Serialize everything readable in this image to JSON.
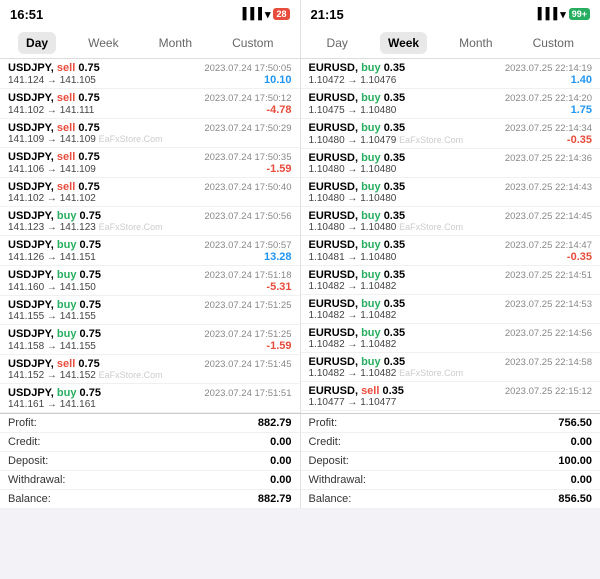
{
  "panels": {
    "left": {
      "time": "16:51",
      "battery": "28",
      "battery_color": "red",
      "active_tab": "Day",
      "tabs": [
        "Day",
        "Week",
        "Month",
        "Custom"
      ],
      "trades": [
        {
          "instrument": "USDJPY",
          "direction": "sell",
          "size": "0.75",
          "datetime": "2023.07.24 17:50:05",
          "price_from": "141.124",
          "price_to": "141.105",
          "pnl": "10.10",
          "pnl_sign": "positive"
        },
        {
          "instrument": "USDJPY",
          "direction": "sell",
          "size": "0.75",
          "datetime": "2023.07.24 17:50:12",
          "price_from": "141.102",
          "price_to": "141.111",
          "pnl": "-4.78",
          "pnl_sign": "negative"
        },
        {
          "instrument": "USDJPY",
          "direction": "sell",
          "size": "0.75",
          "datetime": "2023.07.24 17:50:29",
          "price_from": "141.109",
          "price_to": "141.109",
          "pnl": "",
          "pnl_sign": ""
        },
        {
          "instrument": "USDJPY",
          "direction": "sell",
          "size": "0.75",
          "datetime": "2023.07.24 17:50:35",
          "price_from": "141.106",
          "price_to": "141.109",
          "pnl": "-1.59",
          "pnl_sign": "negative"
        },
        {
          "instrument": "USDJPY",
          "direction": "sell",
          "size": "0.75",
          "datetime": "2023.07.24 17:50:40",
          "price_from": "141.102",
          "price_to": "141.102",
          "pnl": "",
          "pnl_sign": ""
        },
        {
          "instrument": "USDJPY",
          "direction": "buy",
          "size": "0.75",
          "datetime": "2023.07.24 17:50:56",
          "price_from": "141.123",
          "price_to": "141.123",
          "pnl": "",
          "pnl_sign": ""
        },
        {
          "instrument": "USDJPY",
          "direction": "buy",
          "size": "0.75",
          "datetime": "2023.07.24 17:50:57",
          "price_from": "141.126",
          "price_to": "141.151",
          "pnl": "13.28",
          "pnl_sign": "positive"
        },
        {
          "instrument": "USDJPY",
          "direction": "buy",
          "size": "0.75",
          "datetime": "2023.07.24 17:51:18",
          "price_from": "141.160",
          "price_to": "141.150",
          "pnl": "-5.31",
          "pnl_sign": "negative"
        },
        {
          "instrument": "USDJPY",
          "direction": "buy",
          "size": "0.75",
          "datetime": "2023.07.24 17:51:25",
          "price_from": "141.155",
          "price_to": "141.155",
          "pnl": "",
          "pnl_sign": ""
        },
        {
          "instrument": "USDJPY",
          "direction": "buy",
          "size": "0.75",
          "datetime": "2023.07.24 17:51:25",
          "price_from": "141.158",
          "price_to": "141.155",
          "pnl": "-1.59",
          "pnl_sign": "negative"
        },
        {
          "instrument": "USDJPY",
          "direction": "sell",
          "size": "0.75",
          "datetime": "2023.07.24 17:51:45",
          "price_from": "141.152",
          "price_to": "141.152",
          "pnl": "",
          "pnl_sign": ""
        },
        {
          "instrument": "USDJPY",
          "direction": "buy",
          "size": "0.75",
          "datetime": "2023.07.24 17:51:51",
          "price_from": "141.161",
          "price_to": "141.161",
          "pnl": "",
          "pnl_sign": ""
        }
      ],
      "summary": [
        {
          "label": "Profit:",
          "value": "882.79"
        },
        {
          "label": "Credit:",
          "value": "0.00"
        },
        {
          "label": "Deposit:",
          "value": "0.00"
        },
        {
          "label": "Withdrawal:",
          "value": "0.00"
        },
        {
          "label": "Balance:",
          "value": "882.79"
        }
      ]
    },
    "right": {
      "time": "21:15",
      "battery": "99+",
      "battery_color": "green",
      "active_tab": "Week",
      "tabs": [
        "Day",
        "Week",
        "Month",
        "Custom"
      ],
      "trades": [
        {
          "instrument": "EURUSD",
          "direction": "buy",
          "size": "0.35",
          "datetime": "2023.07.25 22:14:19",
          "price_from": "1.10472",
          "price_to": "1.10476",
          "pnl": "1.40",
          "pnl_sign": "positive"
        },
        {
          "instrument": "EURUSD",
          "direction": "buy",
          "size": "0.35",
          "datetime": "2023.07.25 22:14:20",
          "price_from": "1.10475",
          "price_to": "1.10480",
          "pnl": "1.75",
          "pnl_sign": "positive"
        },
        {
          "instrument": "EURUSD",
          "direction": "buy",
          "size": "0.35",
          "datetime": "2023.07.25 22:14:34",
          "price_from": "1.10480",
          "price_to": "1.10479",
          "pnl": "-0.35",
          "pnl_sign": "negative"
        },
        {
          "instrument": "EURUSD",
          "direction": "buy",
          "size": "0.35",
          "datetime": "2023.07.25 22:14:36",
          "price_from": "1.10480",
          "price_to": "1.10480",
          "pnl": "",
          "pnl_sign": ""
        },
        {
          "instrument": "EURUSD",
          "direction": "buy",
          "size": "0.35",
          "datetime": "2023.07.25 22:14:43",
          "price_from": "1.10480",
          "price_to": "1.10480",
          "pnl": "",
          "pnl_sign": ""
        },
        {
          "instrument": "EURUSD",
          "direction": "buy",
          "size": "0.35",
          "datetime": "2023.07.25 22:14:45",
          "price_from": "1.10480",
          "price_to": "1.10480",
          "pnl": "",
          "pnl_sign": ""
        },
        {
          "instrument": "EURUSD",
          "direction": "buy",
          "size": "0.35",
          "datetime": "2023.07.25 22:14:47",
          "price_from": "1.10481",
          "price_to": "1.10480",
          "pnl": "-0.35",
          "pnl_sign": "negative"
        },
        {
          "instrument": "EURUSD",
          "direction": "buy",
          "size": "0.35",
          "datetime": "2023.07.25 22:14:51",
          "price_from": "1.10482",
          "price_to": "1.10482",
          "pnl": "",
          "pnl_sign": ""
        },
        {
          "instrument": "EURUSD",
          "direction": "buy",
          "size": "0.35",
          "datetime": "2023.07.25 22:14:53",
          "price_from": "1.10482",
          "price_to": "1.10482",
          "pnl": "",
          "pnl_sign": ""
        },
        {
          "instrument": "EURUSD",
          "direction": "buy",
          "size": "0.35",
          "datetime": "2023.07.25 22:14:56",
          "price_from": "1.10482",
          "price_to": "1.10482",
          "pnl": "",
          "pnl_sign": ""
        },
        {
          "instrument": "EURUSD",
          "direction": "buy",
          "size": "0.35",
          "datetime": "2023.07.25 22:14:58",
          "price_from": "1.10482",
          "price_to": "1.10482",
          "pnl": "",
          "pnl_sign": ""
        },
        {
          "instrument": "EURUSD",
          "direction": "sell",
          "size": "0.35",
          "datetime": "2023.07.25 22:15:12",
          "price_from": "1.10477",
          "price_to": "1.10477",
          "pnl": "",
          "pnl_sign": ""
        }
      ],
      "summary": [
        {
          "label": "Profit:",
          "value": "756.50"
        },
        {
          "label": "Credit:",
          "value": "0.00"
        },
        {
          "label": "Deposit:",
          "value": "100.00"
        },
        {
          "label": "Withdrawal:",
          "value": "0.00"
        },
        {
          "label": "Balance:",
          "value": "856.50"
        }
      ]
    }
  },
  "watermark": "EaFxStore.Com"
}
